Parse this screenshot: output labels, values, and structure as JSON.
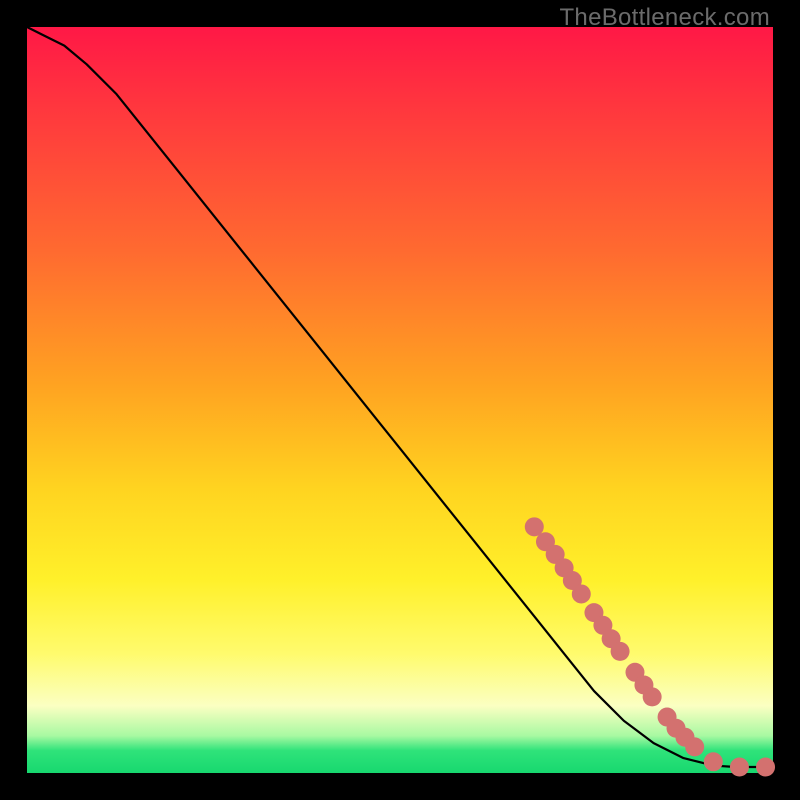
{
  "watermark": "TheBottleneck.com",
  "colors": {
    "background": "#000000",
    "curve": "#000000",
    "marker_fill": "#d3716f",
    "marker_stroke": "#d3716f"
  },
  "chart_data": {
    "type": "line",
    "title": "",
    "xlabel": "",
    "ylabel": "",
    "xlim": [
      0,
      100
    ],
    "ylim": [
      0,
      100
    ],
    "grid": false,
    "legend": false,
    "series": [
      {
        "name": "curve",
        "x": [
          0,
          2,
          5,
          8,
          12,
          20,
          30,
          40,
          50,
          60,
          68,
          72,
          76,
          80,
          84,
          88,
          92,
          95,
          97,
          100
        ],
        "y": [
          100,
          99,
          97.5,
          95,
          91,
          81,
          68.5,
          56,
          43.5,
          31,
          21,
          16,
          11,
          7,
          4,
          2,
          1,
          0.8,
          0.8,
          0.8
        ]
      }
    ],
    "markers": [
      {
        "name": "m1",
        "x": 68.0,
        "y": 33.0
      },
      {
        "name": "m2",
        "x": 69.5,
        "y": 31.0
      },
      {
        "name": "m3",
        "x": 70.8,
        "y": 29.3
      },
      {
        "name": "m4",
        "x": 72.0,
        "y": 27.5
      },
      {
        "name": "m5",
        "x": 73.1,
        "y": 25.8
      },
      {
        "name": "m6",
        "x": 74.3,
        "y": 24.0
      },
      {
        "name": "m7",
        "x": 76.0,
        "y": 21.5
      },
      {
        "name": "m8",
        "x": 77.2,
        "y": 19.8
      },
      {
        "name": "m9",
        "x": 78.3,
        "y": 18.0
      },
      {
        "name": "m10",
        "x": 79.5,
        "y": 16.3
      },
      {
        "name": "m11",
        "x": 81.5,
        "y": 13.5
      },
      {
        "name": "m12",
        "x": 82.7,
        "y": 11.8
      },
      {
        "name": "m13",
        "x": 83.8,
        "y": 10.2
      },
      {
        "name": "m14",
        "x": 85.8,
        "y": 7.5
      },
      {
        "name": "m15",
        "x": 87.0,
        "y": 6.0
      },
      {
        "name": "m16",
        "x": 88.2,
        "y": 4.8
      },
      {
        "name": "m17",
        "x": 89.5,
        "y": 3.5
      },
      {
        "name": "m18",
        "x": 92.0,
        "y": 1.5
      },
      {
        "name": "m19",
        "x": 95.5,
        "y": 0.8
      },
      {
        "name": "m20",
        "x": 99.0,
        "y": 0.8
      }
    ]
  }
}
